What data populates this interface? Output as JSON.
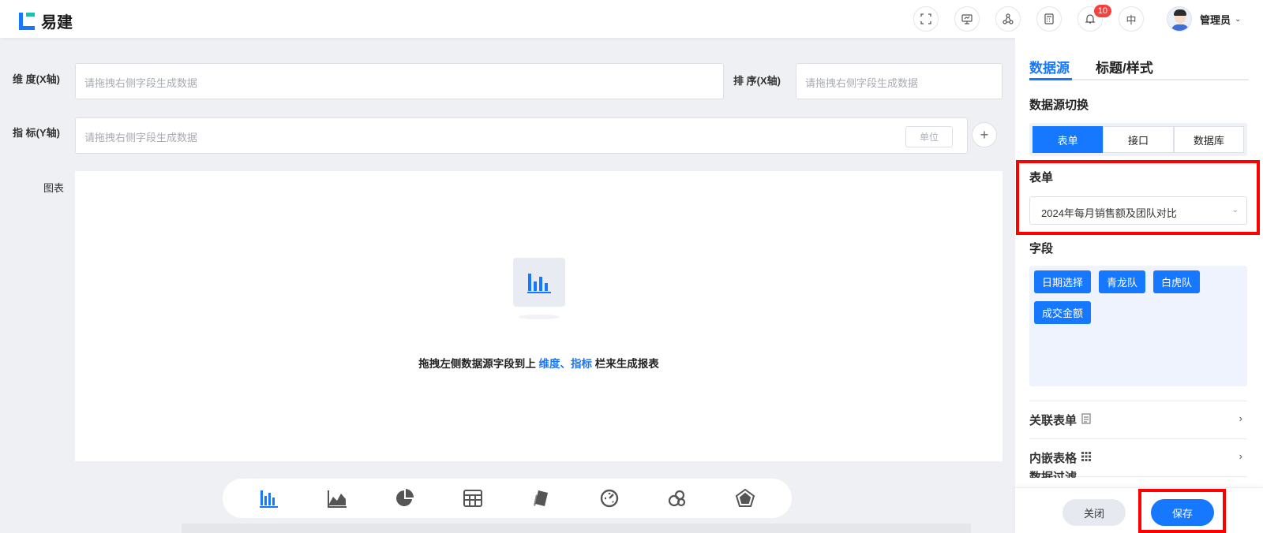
{
  "header": {
    "logo_text": "易建",
    "notification_count": "10",
    "lang": "中",
    "user_name": "管理员"
  },
  "main": {
    "dimension_label": "维 度(X轴)",
    "dimension_placeholder": "请拖拽右侧字段生成数据",
    "sort_label": "排 序(X轴)",
    "sort_placeholder": "请拖拽右侧字段生成数据",
    "metric_label": "指 标(Y轴)",
    "metric_placeholder": "请拖拽右侧字段生成数据",
    "unit_label": "单位",
    "chart_label": "图表",
    "empty_prefix": "拖拽左侧数据源字段到上 ",
    "empty_highlight": "维度、指标",
    "empty_suffix": " 栏来生成报表",
    "chart_types": [
      "bar-chart-icon",
      "area-chart-icon",
      "pie-chart-icon",
      "table-icon",
      "cards-icon",
      "gauge-icon",
      "funnel-icon",
      "radar-chart-icon"
    ]
  },
  "panel": {
    "tabs": [
      "数据源",
      "标题/样式"
    ],
    "source_switch_title": "数据源切换",
    "source_options": [
      "表单",
      "接口",
      "数据库"
    ],
    "form_title": "表单",
    "form_selected": "2024年每月销售额及团队对比",
    "fields_title": "字段",
    "fields": [
      "日期选择",
      "青龙队",
      "白虎队",
      "成交金额"
    ],
    "related_form": "关联表单",
    "embedded_table": "内嵌表格",
    "data_filter": "数据过滤",
    "close_label": "关闭",
    "save_label": "保存"
  },
  "colors": {
    "primary": "#1677ff",
    "highlight_box": "#ff0000",
    "badge": "#f5423f"
  }
}
